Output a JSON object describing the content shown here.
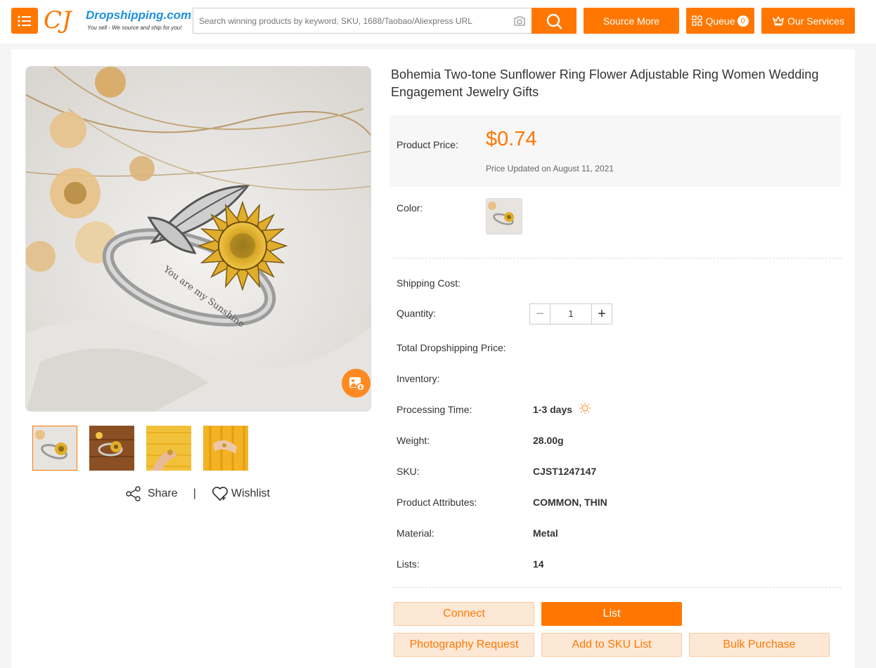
{
  "header": {
    "search_placeholder": "Search winning products by keyword, SKU, 1688/Taobao/Aliexpress URL",
    "source_more": "Source More",
    "queue": "Queue",
    "queue_count": "0",
    "our_services": "Our Services"
  },
  "logo": {
    "cj": "CJ",
    "site": "Dropshipping.com",
    "tagline": "You sell - We source and ship for you!"
  },
  "product": {
    "title": "Bohemia Two-tone Sunflower Ring Flower Adjustable Ring Women Wedding Engagement Jewelry Gifts",
    "price_label": "Product Price:",
    "price": "$0.74",
    "price_updated": "Price Updated on August 11, 2021",
    "color_label": "Color:",
    "shipping_label": "Shipping Cost:",
    "quantity_label": "Quantity:",
    "quantity": "1",
    "total_label": "Total Dropshipping Price:",
    "inventory_label": "Inventory:",
    "processing_label": "Processing Time:",
    "processing_value": "1-3 days",
    "weight_label": "Weight:",
    "weight_value": "28.00g",
    "sku_label": "SKU:",
    "sku_value": "CJST1247147",
    "attributes_label": "Product Attributes:",
    "attributes_value": "COMMON, THIN",
    "material_label": "Material:",
    "material_value": "Metal",
    "lists_label": "Lists:",
    "lists_value": "14",
    "ring_engraving": "You are my Sunshine"
  },
  "gallery": {
    "share": "Share",
    "separator": "|",
    "wishlist": "Wishlist"
  },
  "actions": {
    "connect": "Connect",
    "list": "List",
    "photography_request": "Photography Request",
    "add_to_sku_list": "Add to SKU List",
    "bulk_purchase": "Bulk Purchase"
  },
  "colors": {
    "accent": "#ff7700",
    "accent_light": "#fde8d6"
  }
}
